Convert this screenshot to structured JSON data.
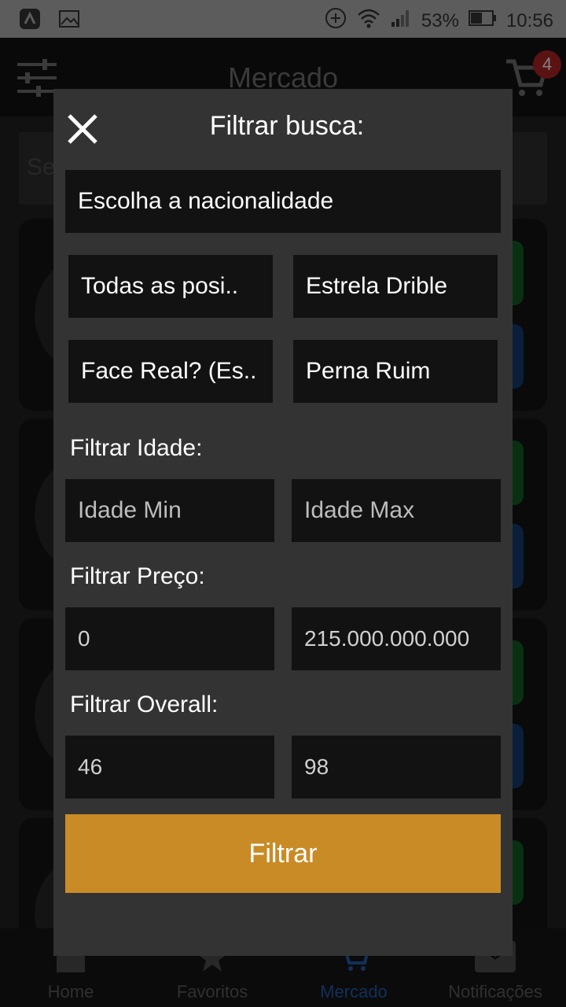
{
  "status_bar": {
    "battery": "53%",
    "time": "10:56"
  },
  "app_bar": {
    "title": "Mercado",
    "cart_count": "4"
  },
  "search": {
    "placeholder_visible": "Se"
  },
  "bottom_nav": [
    {
      "label": "Home",
      "icon": "home-icon",
      "active": false
    },
    {
      "label": "Favoritos",
      "icon": "star-icon",
      "active": false
    },
    {
      "label": "Mercado",
      "icon": "cart-icon",
      "active": true
    },
    {
      "label": "Notificações",
      "icon": "mail-icon",
      "active": false
    }
  ],
  "modal": {
    "title": "Filtrar busca:",
    "nationality": "Escolha a nacionalidade",
    "position": "Todas as posi..",
    "star_dribble": "Estrela Drible",
    "real_face": "Face Real? (Es..",
    "weak_foot": "Perna Ruim",
    "age_label": "Filtrar Idade:",
    "age_min_placeholder": "Idade Min",
    "age_max_placeholder": "Idade Max",
    "price_label": "Filtrar Preço:",
    "price_min": "0",
    "price_max": "215.000.000.000",
    "overall_label": "Filtrar Overall:",
    "overall_min": "46",
    "overall_max": "98",
    "submit_label": "Filtrar"
  },
  "colors": {
    "accent": "#c98b26",
    "modal_bg": "#333333",
    "field_bg": "#121212",
    "badge": "#8a1c1c",
    "nav_active": "#1d4a8a"
  }
}
